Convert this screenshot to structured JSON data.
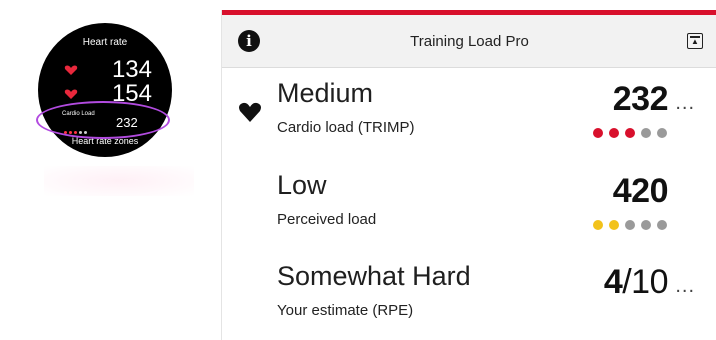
{
  "colors": {
    "accent": "#d8102c",
    "dot_red": "#d8102c",
    "dot_yellow": "#f2c21b",
    "dot_gray": "#9a9a9a",
    "ring": "#b24be0"
  },
  "watch": {
    "title": "Heart rate",
    "hr_values": [
      "134",
      "154"
    ],
    "cardio_label": "Cardio Load",
    "cardio_value": "232",
    "zones_label": "Heart rate zones"
  },
  "header": {
    "info_icon": "info-icon",
    "title": "Training Load Pro",
    "export_icon": "export-icon"
  },
  "rows": [
    {
      "title": "Medium",
      "subtitle": "Cardio load (TRIMP)",
      "value": "232",
      "more": "...",
      "dots": [
        "red",
        "red",
        "red",
        "gray",
        "gray"
      ]
    },
    {
      "title": "Low",
      "subtitle": "Perceived load",
      "value": "420",
      "dots": [
        "yellow",
        "yellow",
        "gray",
        "gray",
        "gray"
      ]
    },
    {
      "title": "Somewhat Hard",
      "subtitle": "Your estimate (RPE)",
      "value_main": "4",
      "value_denom": "/10",
      "more": "..."
    }
  ]
}
